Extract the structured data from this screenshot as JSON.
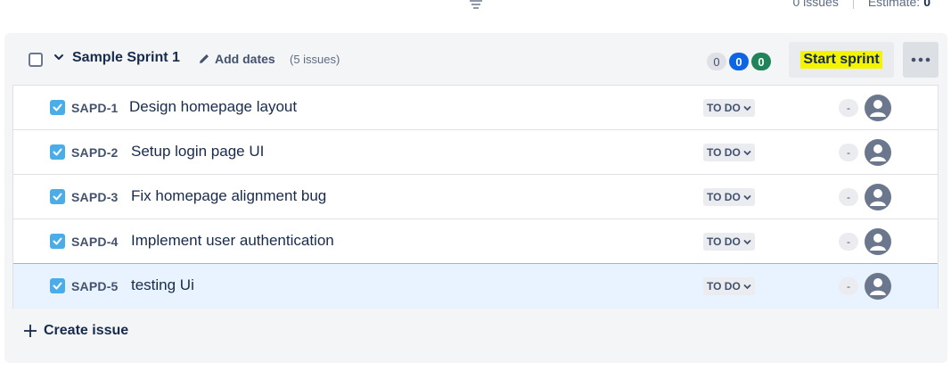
{
  "top": {
    "issues_text": "0 issues",
    "estimate_label": "Estimate:",
    "estimate_value": "0"
  },
  "sprint": {
    "name": "Sample Sprint 1",
    "add_dates_label": "Add dates",
    "issue_count": "(5 issues)",
    "status_counts": {
      "todo": "0",
      "in_progress": "0",
      "done": "0"
    },
    "start_sprint_label": "Start sprint",
    "more_icon": "more-horizontal-icon"
  },
  "issues": [
    {
      "key": "SAPD-1",
      "summary": "Design homepage layout",
      "status": "TO DO",
      "estimate": "-"
    },
    {
      "key": "SAPD-2",
      "summary": "Setup login page UI",
      "status": "TO DO",
      "estimate": "-"
    },
    {
      "key": "SAPD-3",
      "summary": "Fix homepage alignment bug",
      "status": "TO DO",
      "estimate": "-"
    },
    {
      "key": "SAPD-4",
      "summary": "Implement user authentication",
      "status": "TO DO",
      "estimate": "-"
    },
    {
      "key": "SAPD-5",
      "summary": "testing Ui",
      "status": "TO DO",
      "estimate": "-"
    }
  ],
  "create_issue_label": "Create issue",
  "colors": {
    "task_icon": "#4bade8",
    "highlight": "#f4f400",
    "in_progress": "#0c66e4",
    "done": "#1f845a",
    "selected_row": "#e9f2ff"
  }
}
